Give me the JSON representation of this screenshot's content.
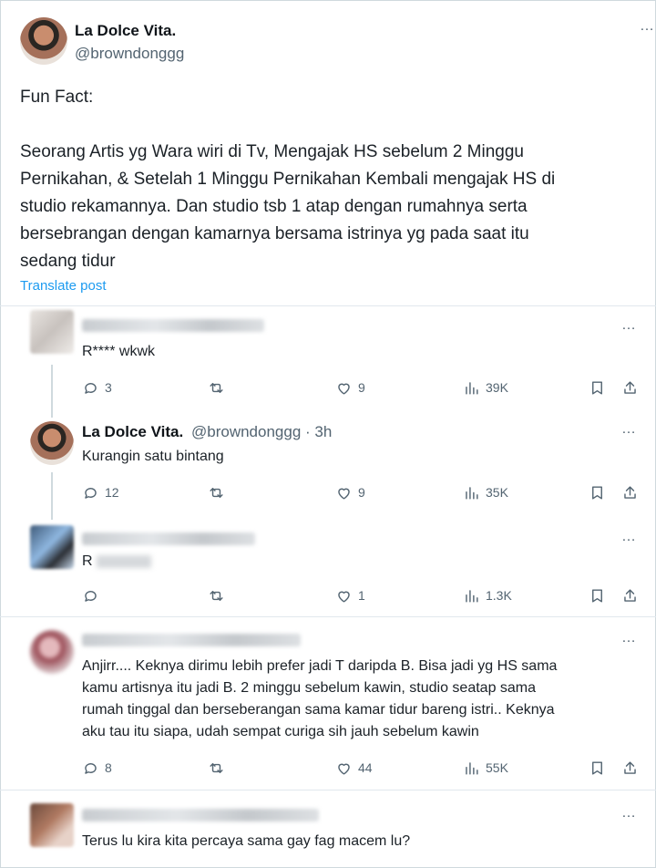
{
  "post": {
    "name": "La Dolce Vita.",
    "handle": "@browndonggg",
    "body": "Fun Fact:\n\nSeorang Artis yg Wara wiri di Tv, Mengajak HS sebelum 2 Minggu\nPernikahan, & Setelah 1 Minggu Pernikahan Kembali mengajak HS di\nstudio rekamannya. Dan studio tsb 1 atap dengan rumahnya serta\nbersebrangan dengan kamarnya bersama istrinya yg pada saat itu\nsedang tidur",
    "translate": "Translate post",
    "more": "…"
  },
  "replies": [
    {
      "text": "R**** wkwk",
      "reply_count": "3",
      "like_count": "9",
      "views": "39K",
      "more": "…"
    },
    {
      "name": "La Dolce Vita.",
      "handle_time": "@browndonggg · 3h",
      "text": "Kurangin satu bintang",
      "reply_count": "12",
      "like_count": "9",
      "views": "35K",
      "more": "…"
    },
    {
      "text": "R",
      "reply_count": "",
      "like_count": "1",
      "views": "1.3K",
      "more": "…"
    },
    {
      "text_lines": [
        "Anjirr.... Keknya dirimu lebih prefer jadi T daripda B. Bisa jadi yg HS sama",
        "kamu artisnya itu jadi B. 2 minggu sebelum kawin, studio seatap sama",
        "rumah tinggal dan berseberangan sama kamar tidur bareng istri.. Keknya",
        "aku tau itu siapa, udah sempat curiga sih jauh sebelum kawin"
      ],
      "reply_count": "8",
      "like_count": "44",
      "views": "55K",
      "more": "…"
    },
    {
      "text": "Terus lu kira kita percaya sama gay fag macem lu?",
      "more": "…"
    }
  ],
  "icons": [
    "reply-icon",
    "retweet-icon",
    "like-icon",
    "views-icon",
    "bookmark-icon",
    "share-icon"
  ],
  "colors": {
    "link": "#1d9bf0",
    "muted": "#536471",
    "text": "#0f1419"
  }
}
